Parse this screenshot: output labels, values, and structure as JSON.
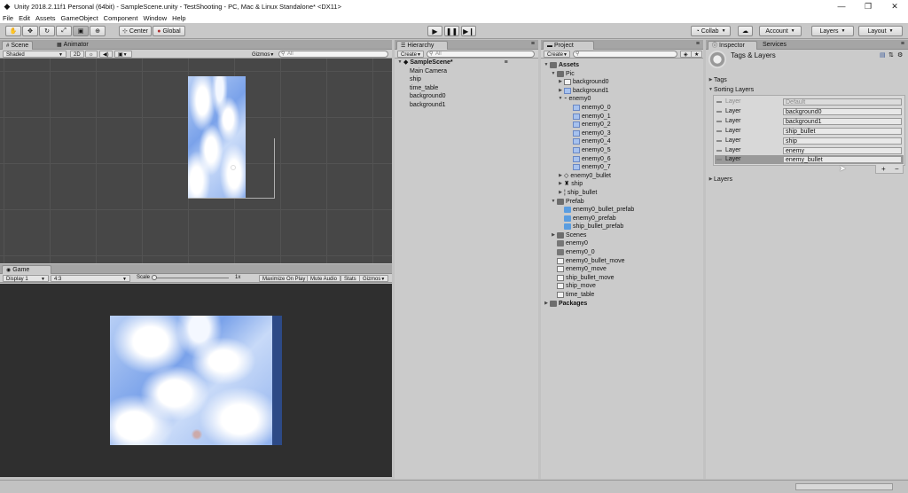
{
  "window": {
    "title": "Unity 2018.2.11f1 Personal (64bit) - SampleScene.unity - TestShooting - PC, Mac & Linux Standalone* <DX11>"
  },
  "menu": [
    "File",
    "Edit",
    "Assets",
    "GameObject",
    "Component",
    "Window",
    "Help"
  ],
  "toolbar": {
    "pivot": "Center",
    "space": "Global",
    "collab": "Collab",
    "account": "Account",
    "layers": "Layers",
    "layout": "Layout"
  },
  "scene": {
    "tabs": [
      "Scene",
      "Animator"
    ],
    "shading": "Shaded",
    "mode2d": "2D",
    "gizmos": "Gizmos",
    "search_placeholder": "All"
  },
  "game": {
    "tab": "Game",
    "display": "Display 1",
    "aspect": "4:3",
    "scale_label": "Scale",
    "scale_value": "1x",
    "maximize": "Maximize On Play",
    "mute": "Mute Audio",
    "stats": "Stats",
    "gizmos": "Gizmos"
  },
  "hierarchy": {
    "tab": "Hierarchy",
    "create": "Create",
    "search_placeholder": "All",
    "scene": "SampleScene*",
    "items": [
      "Main Camera",
      "ship",
      "time_table",
      "background0",
      "background1"
    ]
  },
  "project": {
    "tab": "Project",
    "create": "Create",
    "assets": "Assets",
    "pic": "Pic",
    "pic_items": [
      "background0",
      "background1",
      "enemy0"
    ],
    "enemy0_frames": [
      "enemy0_0",
      "enemy0_1",
      "enemy0_2",
      "enemy0_3",
      "enemy0_4",
      "enemy0_5",
      "enemy0_6",
      "enemy0_7"
    ],
    "pic_items_after": [
      "enemy0_bullet",
      "ship",
      "ship_bullet"
    ],
    "prefab": "Prefab",
    "prefab_items": [
      "enemy0_bullet_prefab",
      "enemy0_prefab",
      "ship_bullet_prefab"
    ],
    "scenes": "Scenes",
    "root_items": [
      "enemy0",
      "enemy0_0",
      "enemy0_bullet_move",
      "enemy0_move",
      "ship_bullet_move",
      "ship_move",
      "time_table"
    ],
    "packages": "Packages"
  },
  "inspector": {
    "tabs": [
      "Inspector",
      "Services"
    ],
    "title": "Tags & Layers",
    "tags": "Tags",
    "sorting_layers": "Sorting Layers",
    "layer_label": "Layer",
    "sorting_values": [
      "Default",
      "background0",
      "background1",
      "ship_bullet",
      "ship",
      "enemy",
      "enemy_bullet"
    ],
    "add": "+",
    "remove": "−",
    "layers": "Layers"
  }
}
